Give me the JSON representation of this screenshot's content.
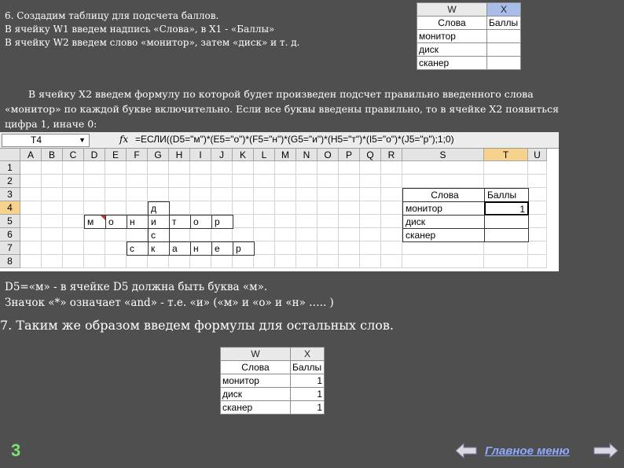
{
  "intro_lines": [
    "6. Создадим таблицу для подсчета баллов.",
    "В ячейку W1 введем надпись «Слова», в X1 - «Баллы»",
    "В ячейку W2 введем слово «монитор», затем «диск» и т. д."
  ],
  "paragraph": "В ячейку X2 введем формулу по которой будет произведен подсчет правильно введенного  слова «монитор» по каждой букве включительно. Если все буквы введены правильно, то в ячейке X2 появиться цифра 1, иначе 0:",
  "top_table": {
    "col_headers": [
      "W",
      "X"
    ],
    "rows": [
      [
        "Слова",
        "Баллы"
      ],
      [
        "монитор",
        ""
      ],
      [
        "диск",
        ""
      ],
      [
        "сканер",
        ""
      ]
    ]
  },
  "sheet": {
    "name_box": "T4",
    "fx": "fx",
    "formula": "=ЕСЛИ((D5=\"м\")*(E5=\"о\")*(F5=\"н\")*(G5=\"и\")*(H5=\"т\")*(I5=\"о\")*(J5=\"р\");1;0)",
    "columns": [
      "A",
      "B",
      "C",
      "D",
      "E",
      "F",
      "G",
      "H",
      "I",
      "J",
      "K",
      "L",
      "M",
      "N",
      "O",
      "P",
      "Q",
      "R",
      "S",
      "T",
      "U"
    ],
    "row_numbers": [
      "1",
      "2",
      "3",
      "4",
      "5",
      "6",
      "7",
      "8"
    ],
    "monitor_letters": [
      "м",
      "о",
      "н",
      "и",
      "т",
      "о",
      "р"
    ],
    "vertical_letters": [
      "д",
      "и",
      "с",
      "к"
    ],
    "scanner_letters": [
      "с",
      "к",
      "а",
      "н",
      "е",
      "р"
    ],
    "score_table": {
      "header": [
        "Слова",
        "Баллы"
      ],
      "rows": [
        [
          "монитор",
          "1"
        ],
        [
          "диск",
          ""
        ],
        [
          "сканер",
          ""
        ]
      ]
    }
  },
  "d5_lines": [
    "D5=«м»   -  в ячейке D5 должна быть буква «м».",
    "Значок «*» означает «and» - т.е. «и»  («м» и «о» и «н» …..  )"
  ],
  "step_seven": "7. Таким же образом введем формулы для остальных слов.",
  "bottom_table": {
    "col_headers": [
      "W",
      "X"
    ],
    "rows": [
      [
        "Слова",
        "Баллы"
      ],
      [
        "монитор",
        "1"
      ],
      [
        "диск",
        "1"
      ],
      [
        "сканер",
        "1"
      ]
    ]
  },
  "footer": {
    "slide_number": "3",
    "menu_link": "Главное меню"
  },
  "colors": {
    "background": "#4f4f4f",
    "selected_header": "#a9bde8",
    "active_header": "#f6d28c",
    "slide_number": "#79e26e",
    "link": "#8fa9ff"
  }
}
